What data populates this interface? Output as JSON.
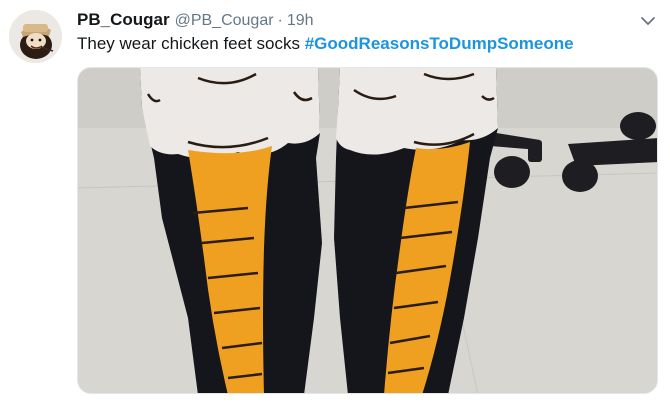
{
  "tweet": {
    "display_name": "PB_Cougar",
    "handle": "@PB_Cougar",
    "separator": "·",
    "time": "19h",
    "text": "They wear chicken feet socks ",
    "hashtag": "#GoodReasonsToDumpSomeone"
  },
  "icons": {
    "menu": "chevron-down-icon",
    "avatar": "cartoon-avatar"
  },
  "colors": {
    "hashtag": "#1b95e0",
    "secondary_text": "#657786",
    "sock_orange": "#f0a020",
    "sock_black": "#15161c",
    "sock_white": "#ece9e6"
  }
}
